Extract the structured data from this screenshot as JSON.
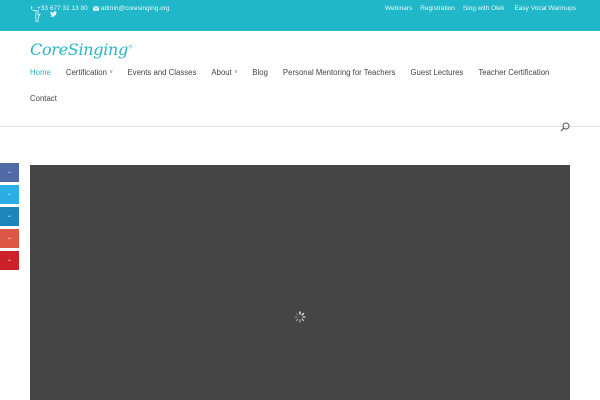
{
  "topbar": {
    "phone": "+33 677 31 13 80",
    "email": "admin@coresinging.org",
    "links": [
      "Webinars",
      "Registration",
      "Sing with Olek",
      "Easy Vocal Warmups"
    ],
    "bg_color": "#20b7c8"
  },
  "logo": {
    "text": "CoreSinging",
    "mark": "®"
  },
  "nav": {
    "row1": [
      {
        "label": "Home",
        "active": true,
        "caret": ""
      },
      {
        "label": "Certification",
        "active": false,
        "caret": "v"
      },
      {
        "label": "Events and Classes",
        "active": false,
        "caret": ""
      },
      {
        "label": "About",
        "active": false,
        "caret": "v"
      },
      {
        "label": "Blog",
        "active": false,
        "caret": ""
      },
      {
        "label": "Personal Mentoring for Teachers",
        "active": false,
        "caret": ""
      },
      {
        "label": "Guest Lectures",
        "active": false,
        "caret": ""
      },
      {
        "label": "Teacher Certification",
        "active": false,
        "caret": ""
      }
    ],
    "row2": [
      {
        "label": "Contact",
        "active": false,
        "caret": ""
      }
    ]
  },
  "social": [
    {
      "icon": "facebook-icon",
      "color": "#4f6aa5"
    },
    {
      "icon": "twitter-icon",
      "color": "#2aaee6"
    },
    {
      "icon": "linkedin-icon",
      "color": "#1d86b9"
    },
    {
      "icon": "googleplus-icon",
      "color": "#dd5545"
    },
    {
      "icon": "pinterest-icon",
      "color": "#cc2129"
    }
  ],
  "video": {
    "bg_color": "#454545"
  },
  "colors": {
    "accent": "#2ab5c4"
  }
}
